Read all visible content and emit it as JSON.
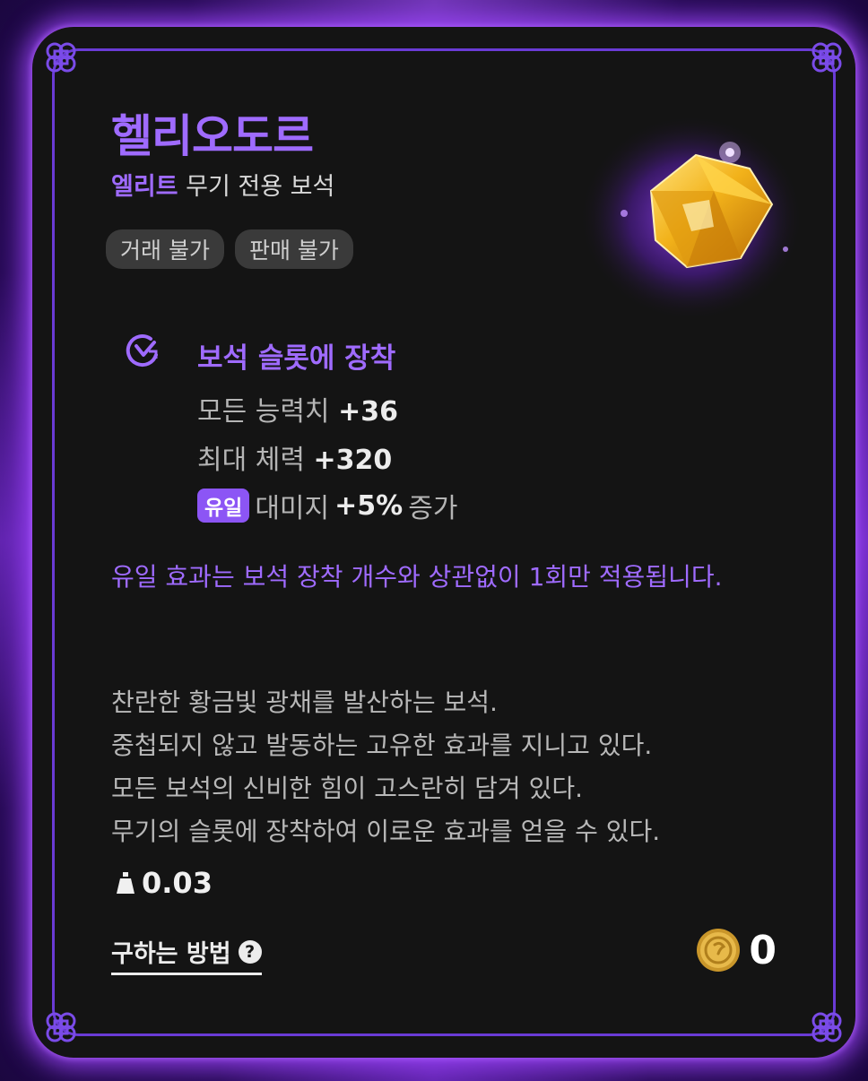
{
  "item": {
    "name": "헬리오도르",
    "grade": "엘리트",
    "category": "무기 전용 보석",
    "tags": [
      "거래 불가",
      "판매 불가"
    ]
  },
  "effect": {
    "title": "보석 슬롯에 장착",
    "stats": [
      {
        "label": "모든 능력치",
        "value": "+36"
      },
      {
        "label": "최대 체력",
        "value": "+320"
      }
    ],
    "unique": {
      "badge": "유일",
      "label": "대미지",
      "value": "+5%",
      "suffix": "증가"
    }
  },
  "note": "유일 효과는 보석 장착 개수와 상관없이 1회만 적용됩니다.",
  "description": [
    "찬란한 황금빛 광채를 발산하는 보석.",
    "중첩되지 않고 발동하는 고유한 효과를 지니고 있다.",
    "모든 보석의 신비한 힘이 고스란히 담겨 있다.",
    "무기의 슬롯에 장착하여 이로운 효과를 얻을 수 있다."
  ],
  "weight": "0.03",
  "how_to_obtain": "구하는 방법",
  "price": "0",
  "colors": {
    "accent": "#9f6bff",
    "card": "#141414",
    "glow": "#a046ff",
    "gem": "#f2b21a"
  },
  "icons": [
    "corner-knot-icon",
    "gem-slot-icon",
    "weight-icon",
    "help-icon",
    "gold-coin-icon"
  ]
}
